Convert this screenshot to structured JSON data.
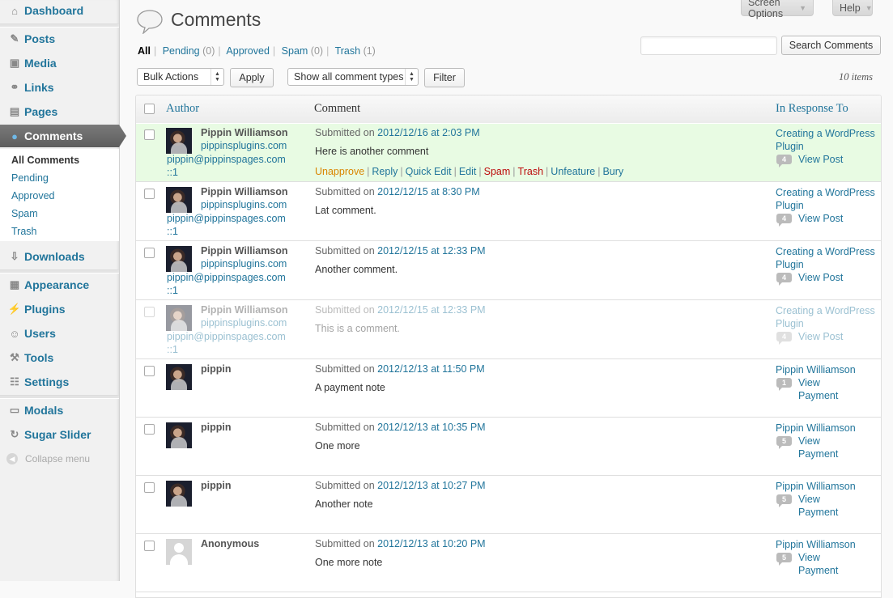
{
  "sidebar": {
    "menu": [
      {
        "id": "dashboard",
        "label": "Dashboard",
        "icon": "home-icon",
        "glyph": "⌂"
      },
      {
        "id": "posts",
        "label": "Posts",
        "icon": "pushpin-icon",
        "glyph": "✎"
      },
      {
        "id": "media",
        "label": "Media",
        "icon": "media-icon",
        "glyph": "▣"
      },
      {
        "id": "links",
        "label": "Links",
        "icon": "link-icon",
        "glyph": "⚭"
      },
      {
        "id": "pages",
        "label": "Pages",
        "icon": "pages-icon",
        "glyph": "▤"
      },
      {
        "id": "comments",
        "label": "Comments",
        "icon": "speech-bubble-icon",
        "glyph": "●"
      },
      {
        "id": "downloads",
        "label": "Downloads",
        "icon": "download-icon",
        "glyph": "⇩"
      },
      {
        "id": "appearance",
        "label": "Appearance",
        "icon": "appearance-icon",
        "glyph": "▦"
      },
      {
        "id": "plugins",
        "label": "Plugins",
        "icon": "plug-icon",
        "glyph": "⚡"
      },
      {
        "id": "users",
        "label": "Users",
        "icon": "users-icon",
        "glyph": "☺"
      },
      {
        "id": "tools",
        "label": "Tools",
        "icon": "tools-icon",
        "glyph": "⚒"
      },
      {
        "id": "settings",
        "label": "Settings",
        "icon": "settings-icon",
        "glyph": "☷"
      },
      {
        "id": "modals",
        "label": "Modals",
        "icon": "modal-icon",
        "glyph": "▭"
      },
      {
        "id": "sugar-slider",
        "label": "Sugar Slider",
        "icon": "slider-icon",
        "glyph": "↻"
      }
    ],
    "submenu": [
      "All Comments",
      "Pending",
      "Approved",
      "Spam",
      "Trash"
    ],
    "collapse_label": "Collapse menu"
  },
  "top_tabs": {
    "screen_options": "Screen Options",
    "help": "Help"
  },
  "page_title": "Comments",
  "filters": [
    {
      "label": "All",
      "count": ""
    },
    {
      "label": "Pending",
      "count": "(0)"
    },
    {
      "label": "Approved",
      "count": ""
    },
    {
      "label": "Spam",
      "count": "(0)"
    },
    {
      "label": "Trash",
      "count": "(1)"
    }
  ],
  "search": {
    "button": "Search Comments",
    "value": ""
  },
  "controls": {
    "bulk_actions": "Bulk Actions",
    "apply": "Apply",
    "comment_types": "Show all comment types",
    "filter": "Filter",
    "items_count": "10 items"
  },
  "table": {
    "headers": {
      "author": "Author",
      "comment": "Comment",
      "in_response_to": "In Response To"
    },
    "submitted_prefix": "Submitted on",
    "rows": [
      {
        "author": "Pippin Williamson",
        "url": "pippinsplugins.com",
        "email": "pippin@pippinspages.com",
        "ip": "::1",
        "date": "2012/12/16 at 2:03 PM",
        "text": "Here is another comment",
        "resp1": "Creating a WordPress",
        "resp2": "Plugin",
        "count": "4",
        "view1": "View Post",
        "view2": ""
      },
      {
        "author": "Pippin Williamson",
        "url": "pippinsplugins.com",
        "email": "pippin@pippinspages.com",
        "ip": "::1",
        "date": "2012/12/15 at 8:30 PM",
        "text": "Lat comment.",
        "resp1": "Creating a WordPress",
        "resp2": "Plugin",
        "count": "4",
        "view1": "View Post",
        "view2": ""
      },
      {
        "author": "Pippin Williamson",
        "url": "pippinsplugins.com",
        "email": "pippin@pippinspages.com",
        "ip": "::1",
        "date": "2012/12/15 at 12:33 PM",
        "text": "Another comment.",
        "resp1": "Creating a WordPress",
        "resp2": "Plugin",
        "count": "4",
        "view1": "View Post",
        "view2": ""
      },
      {
        "author": "Pippin Williamson",
        "url": "pippinsplugins.com",
        "email": "pippin@pippinspages.com",
        "ip": "::1",
        "date": "2012/12/15 at 12:33 PM",
        "text": "This is a comment.",
        "resp1": "Creating a WordPress",
        "resp2": "Plugin",
        "count": "4",
        "view1": "View Post",
        "view2": ""
      },
      {
        "author": "pippin",
        "url": "",
        "email": "",
        "ip": "",
        "date": "2012/12/13 at 11:50 PM",
        "text": "A payment note",
        "resp1": "Pippin Williamson",
        "resp2": "",
        "count": "1",
        "view1": "View",
        "view2": "Payment"
      },
      {
        "author": "pippin",
        "url": "",
        "email": "",
        "ip": "",
        "date": "2012/12/13 at 10:35 PM",
        "text": "One more",
        "resp1": "Pippin Williamson",
        "resp2": "",
        "count": "5",
        "view1": "View",
        "view2": "Payment"
      },
      {
        "author": "pippin",
        "url": "",
        "email": "",
        "ip": "",
        "date": "2012/12/13 at 10:27 PM",
        "text": "Another note",
        "resp1": "Pippin Williamson",
        "resp2": "",
        "count": "5",
        "view1": "View",
        "view2": "Payment"
      },
      {
        "author": "Anonymous",
        "url": "",
        "email": "",
        "ip": "",
        "date": "2012/12/13 at 10:20 PM",
        "text": "One more note",
        "resp1": "Pippin Williamson",
        "resp2": "",
        "count": "5",
        "view1": "View",
        "view2": "Payment"
      }
    ],
    "row_actions": [
      "Unapprove",
      "Reply",
      "Quick Edit",
      "Edit",
      "Spam",
      "Trash",
      "Unfeature",
      "Bury"
    ]
  },
  "colors": {
    "link": "#21759b",
    "unapproved_bg": "#e8fbe3",
    "unapprove_action": "#d98500",
    "spam_action": "#bc0b0b"
  }
}
